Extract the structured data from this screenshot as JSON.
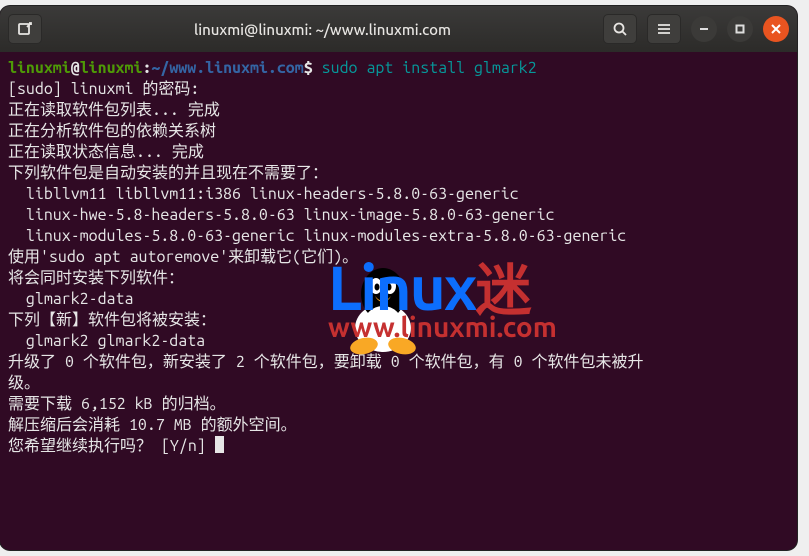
{
  "titlebar": {
    "title": "linuxmi@linuxmi: ~/www.linuxmi.com",
    "new_tab_icon": "new-tab-icon",
    "search_icon": "search-icon",
    "menu_icon": "hamburger-icon",
    "min_icon": "minimize-icon",
    "max_icon": "maximize-icon",
    "close_icon": "close-icon"
  },
  "prompt": {
    "user": "linuxmi",
    "at": "@",
    "host": "linuxmi",
    "colon": ":",
    "path": "~/www.linuxmi.com",
    "dollar": "$ ",
    "command": "sudo apt install glmark2"
  },
  "lines": {
    "l01": "[sudo] linuxmi 的密码: ",
    "l02": "正在读取软件包列表... 完成",
    "l03": "正在分析软件包的依赖关系树       ",
    "l04": "正在读取状态信息... 完成       ",
    "l05": "下列软件包是自动安装的并且现在不需要了：",
    "l06": "  libllvm11 libllvm11:i386 linux-headers-5.8.0-63-generic",
    "l07": "  linux-hwe-5.8-headers-5.8.0-63 linux-image-5.8.0-63-generic",
    "l08": "  linux-modules-5.8.0-63-generic linux-modules-extra-5.8.0-63-generic",
    "l09": "使用'sudo apt autoremove'来卸载它(它们)。",
    "l10": "将会同时安装下列软件：",
    "l11": "  glmark2-data",
    "l12": "下列【新】软件包将被安装：",
    "l13": "  glmark2 glmark2-data",
    "l14": "升级了 0 个软件包，新安装了 2 个软件包，要卸载 0 个软件包，有 0 个软件包未被升",
    "l15": "级。",
    "l16": "需要下载 6,152 kB 的归档。",
    "l17": "解压缩后会消耗 10.7 MB 的额外空间。",
    "l18": "您希望继续执行吗？ [Y/n] "
  },
  "watermark": {
    "brand_l": "L",
    "brand_inux": "inux",
    "brand_cn": "迷",
    "url": "www.linuxmi.com"
  }
}
